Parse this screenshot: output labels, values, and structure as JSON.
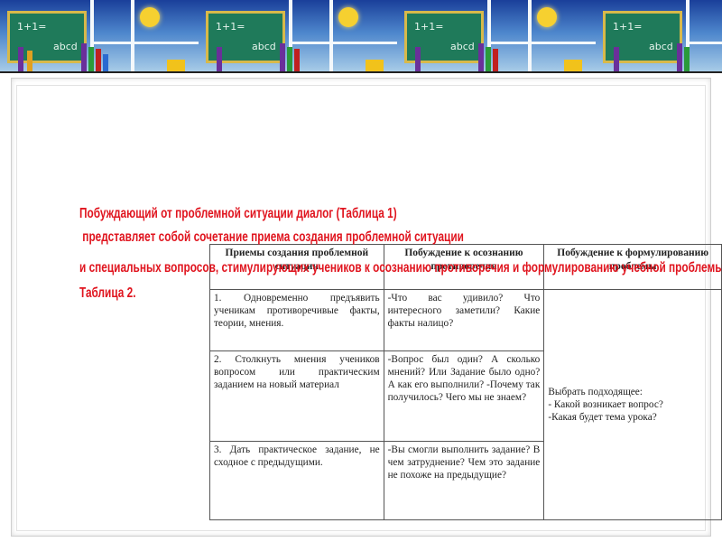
{
  "banner": {
    "board_text_1": "1+1=",
    "board_text_2": "abcd"
  },
  "overlay": {
    "line1": "Побуждающий от проблемной ситуации диалог (Таблица 1)",
    "line2": " представляет собой сочетание приема создания проблемной ситуации",
    "line3": "и специальных вопросов, стимулирующих учеников к осознанию противоречия и формулированию учебной проблемы.",
    "line4": "Таблица 2."
  },
  "table": {
    "headers": [
      "Приемы создания проблемной ситуации",
      "Побуждение к осознанию противоречия",
      "Побуждение к формулированию проблемы"
    ],
    "rows": [
      {
        "technique": "1. Одновременно предъявить ученикам противоречивые факты, теории, мнения.",
        "contradiction": "-Что вас удивило? Что интересного заметили? Какие факты налицо?"
      },
      {
        "technique": "2. Столкнуть мнения учеников вопросом или практическим заданием на новый материал",
        "contradiction": "-Вопрос был один? А сколько мнений? Или Задание было одно? А как его выполнили? -Почему так получилось? Чего мы не знаем?"
      },
      {
        "technique": "3. Дать практическое задание, не сходное с предыдущими.",
        "contradiction": "-Вы смогли выполнить задание? В чем затруднение? Чем это задание не похоже на предыдущие?"
      }
    ],
    "formulation": {
      "intro": "Выбрать подходящее:",
      "q1": "- Какой возникает вопрос?",
      "q2": "-Какая будет тема урока?"
    }
  }
}
